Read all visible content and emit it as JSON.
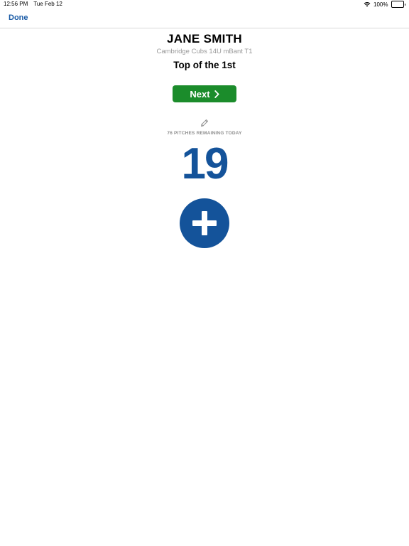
{
  "status_bar": {
    "time": "12:56 PM",
    "date": "Tue Feb 12",
    "battery": "100%",
    "icons": [
      "wifi-icon",
      "battery-icon"
    ]
  },
  "nav": {
    "done_label": "Done"
  },
  "player": {
    "name": "JANE SMITH",
    "team": "Cambridge Cubs 14U mBant T1",
    "inning": "Top of the 1st"
  },
  "actions": {
    "next_label": "Next",
    "next_icon": "chevron-right-icon",
    "edit_icon": "pencil-icon",
    "add_icon": "plus-icon"
  },
  "pitches": {
    "remaining_text": "76 PITCHES REMAINING TODAY",
    "count": "19"
  },
  "colors": {
    "accent_blue": "#14539a",
    "next_green": "#1b8c2b",
    "secondary_gray": "#999999"
  }
}
